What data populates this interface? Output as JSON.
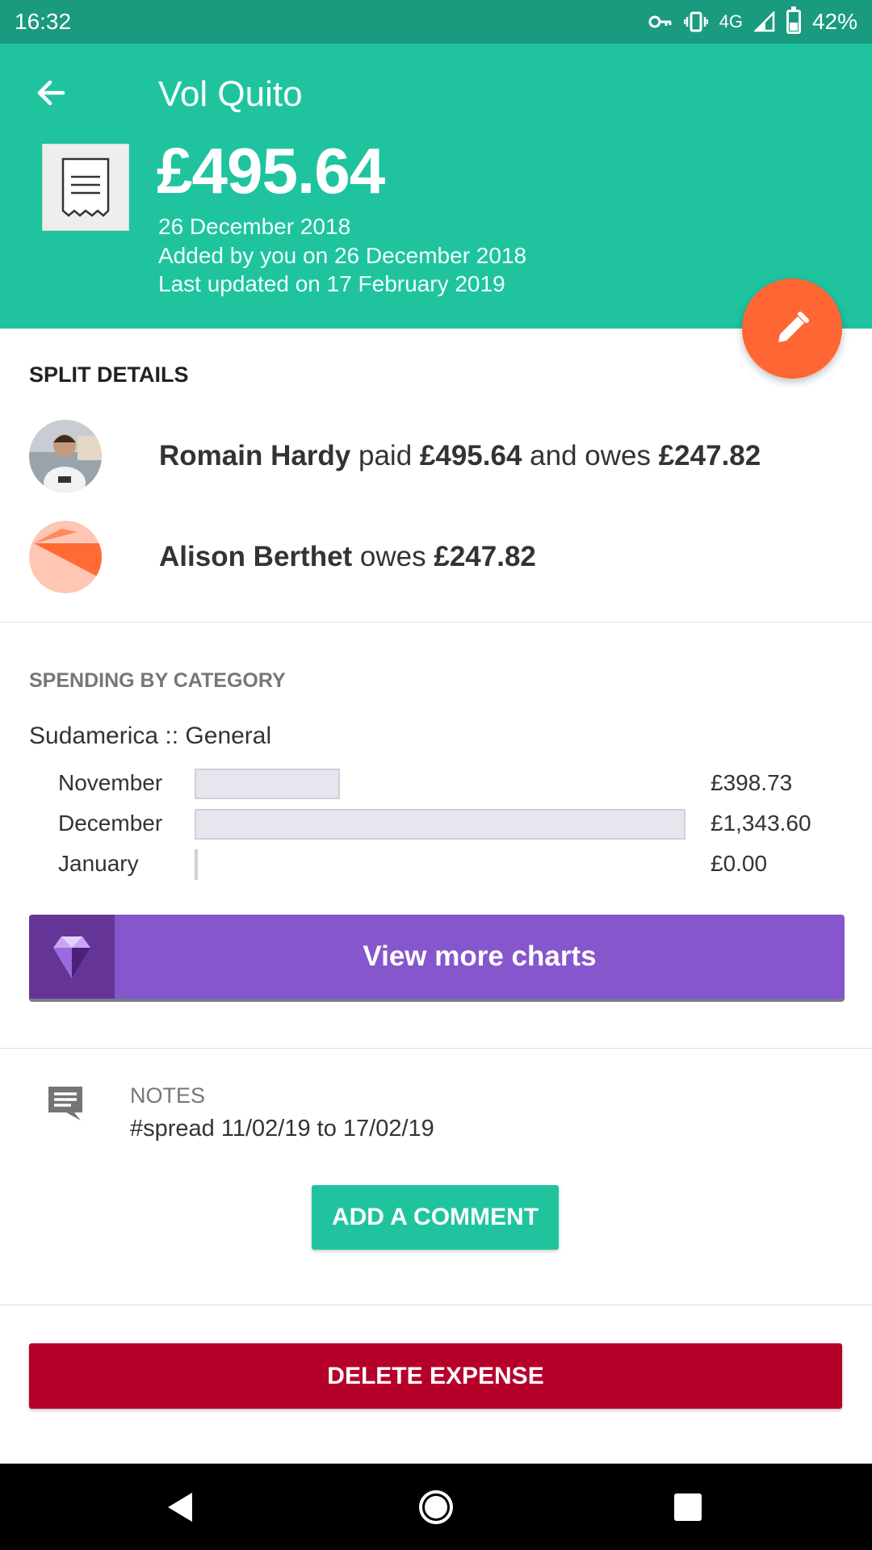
{
  "status_bar": {
    "time": "16:32",
    "network": "4G",
    "battery": "42%"
  },
  "header": {
    "title": "Vol Quito",
    "amount": "£495.64",
    "date": "26 December 2018",
    "added": "Added by you on 26 December 2018",
    "updated": "Last updated on 17 February 2019",
    "color": "#1fc49f"
  },
  "split": {
    "title": "SPLIT DETAILS",
    "rows": [
      {
        "name": "Romain Hardy",
        "verb1": " paid ",
        "paid": "£495.64",
        "verb2": " and owes ",
        "owes": "£247.82"
      },
      {
        "name": "Alison Berthet",
        "verb2": " owes ",
        "owes": "£247.82"
      }
    ]
  },
  "spending": {
    "title": "SPENDING BY CATEGORY",
    "category": "Sudamerica :: General",
    "months": [
      {
        "label": "November",
        "value": "£398.73",
        "amount": 398.73
      },
      {
        "label": "December",
        "value": "£1,343.60",
        "amount": 1343.6
      },
      {
        "label": "January",
        "value": "£0.00",
        "amount": 0
      }
    ]
  },
  "charts_button": {
    "label": "View more charts",
    "icon": "gem-icon",
    "color": "#8656cd"
  },
  "notes": {
    "label": "NOTES",
    "text": "#spread 11/02/19 to 17/02/19",
    "icon": "comment-icon"
  },
  "comment_button": {
    "label": "ADD A COMMENT"
  },
  "delete_button": {
    "label": "DELETE EXPENSE",
    "color": "#b5002a"
  }
}
